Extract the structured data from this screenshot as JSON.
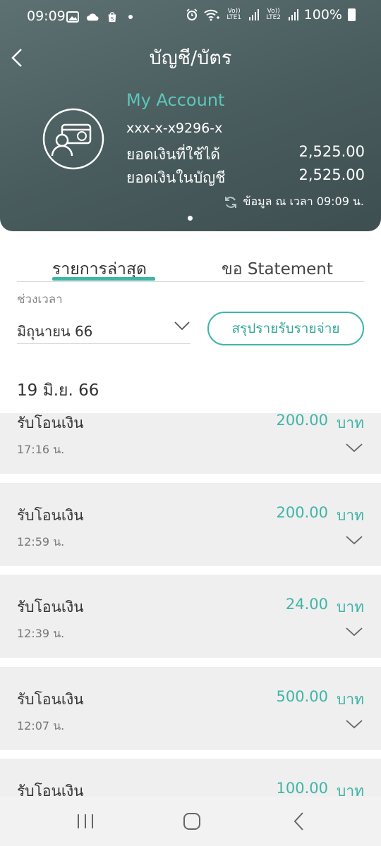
{
  "status_bar": {
    "time": "09:09",
    "battery": "100%",
    "sim1": "Vo)) LTE1",
    "sim2": "Vo)) LTE2"
  },
  "header": {
    "title": "บัญชี/บัตร",
    "account_name": "My Account",
    "account_number": "xxx-x-x9296-x",
    "available_label": "ยอดเงินที่ใช้ได้",
    "available_value": "2,525.00",
    "ledger_label": "ยอดเงินในบัญชี",
    "ledger_value": "2,525.00",
    "updated_text": "ข้อมูล ณ เวลา 09:09 น."
  },
  "tabs": [
    {
      "label": "รายการล่าสุด",
      "active": true
    },
    {
      "label": "ขอ Statement",
      "active": false
    }
  ],
  "filter": {
    "period_label": "ช่วงเวลา",
    "period_value": "มิถุนายน 66",
    "summary_button": "สรุปรายรับรายจ่าย"
  },
  "date_heading": "19 มิ.ย. 66",
  "transactions": [
    {
      "title": "รับโอนเงิน",
      "amount": "200.00",
      "currency": "บาท",
      "time": "17:16 น."
    },
    {
      "title": "รับโอนเงิน",
      "amount": "200.00",
      "currency": "บาท",
      "time": "12:59 น."
    },
    {
      "title": "รับโอนเงิน",
      "amount": "24.00",
      "currency": "บาท",
      "time": "12:39 น."
    },
    {
      "title": "รับโอนเงิน",
      "amount": "500.00",
      "currency": "บาท",
      "time": "12:07 น."
    },
    {
      "title": "รับโอนเงิน",
      "amount": "100.00",
      "currency": "บาท",
      "time": ""
    }
  ],
  "colors": {
    "accent": "#3fb5a8",
    "header_bg": "#4b5e60",
    "card_bg": "#efefef"
  },
  "icons": {
    "back": "chevron-left-icon",
    "account": "account-card-icon",
    "refresh": "refresh-icon",
    "dropdown": "chevron-down-icon"
  }
}
